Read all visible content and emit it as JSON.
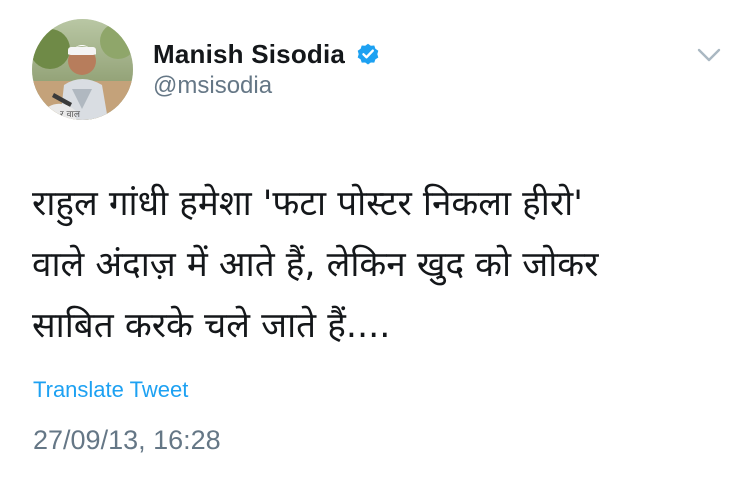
{
  "author": {
    "display_name": "Manish Sisodia",
    "handle": "@msisodia",
    "verified": true,
    "avatar_icon": "profile-photo",
    "avatar_caption": "र वाल"
  },
  "menu": {
    "icon": "chevron-down-icon"
  },
  "tweet": {
    "lines": [
      "राहुल गांधी हमेशा 'फटा पोस्टर निकला हीरो'",
      "वाले अंदाज़ में आते हैं, लेकिन खुद को जोकर",
      "साबित करके चले जाते हैं...."
    ],
    "translate_label": "Translate Tweet",
    "timestamp": "27/09/13, 16:28"
  },
  "colors": {
    "text": "#14171a",
    "secondary": "#657786",
    "link": "#1da1f2",
    "verified": "#1da1f2"
  }
}
